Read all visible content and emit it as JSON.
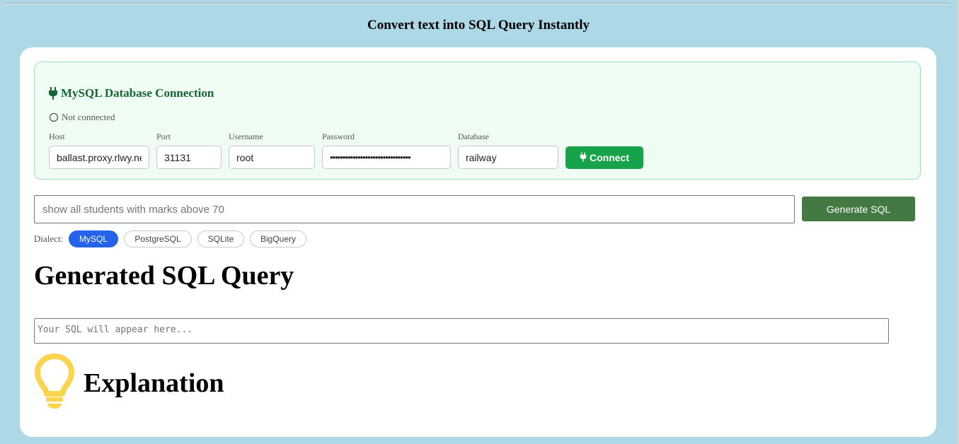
{
  "page": {
    "title": "Convert text into SQL Query Instantly"
  },
  "connection": {
    "heading": "MySQL Database Connection",
    "status": "Not connected",
    "fields": {
      "host": {
        "label": "Host",
        "value": "ballast.proxy.rlwy.net"
      },
      "port": {
        "label": "Port",
        "value": "31131"
      },
      "username": {
        "label": "Username",
        "value": "root"
      },
      "password": {
        "label": "Password",
        "value": "••••••••••••••••••••••••••••••••"
      },
      "database": {
        "label": "Database",
        "value": "railway"
      }
    },
    "connect_label": "Connect",
    "accent": "#16a34a"
  },
  "query": {
    "placeholder": "show all students with marks above 70",
    "generate_label": "Generate SQL",
    "generate_color": "#437a44"
  },
  "dialect": {
    "label": "Dialect:",
    "options": [
      "MySQL",
      "PostgreSQL",
      "SQLite",
      "BigQuery"
    ],
    "selected": "MySQL",
    "active_color": "#2563eb"
  },
  "output": {
    "heading": "Generated SQL Query",
    "placeholder": "Your SQL will appear here..."
  },
  "explanation": {
    "heading": "Explanation",
    "icon": "lightbulb-icon",
    "icon_color": "#fcd34d"
  }
}
